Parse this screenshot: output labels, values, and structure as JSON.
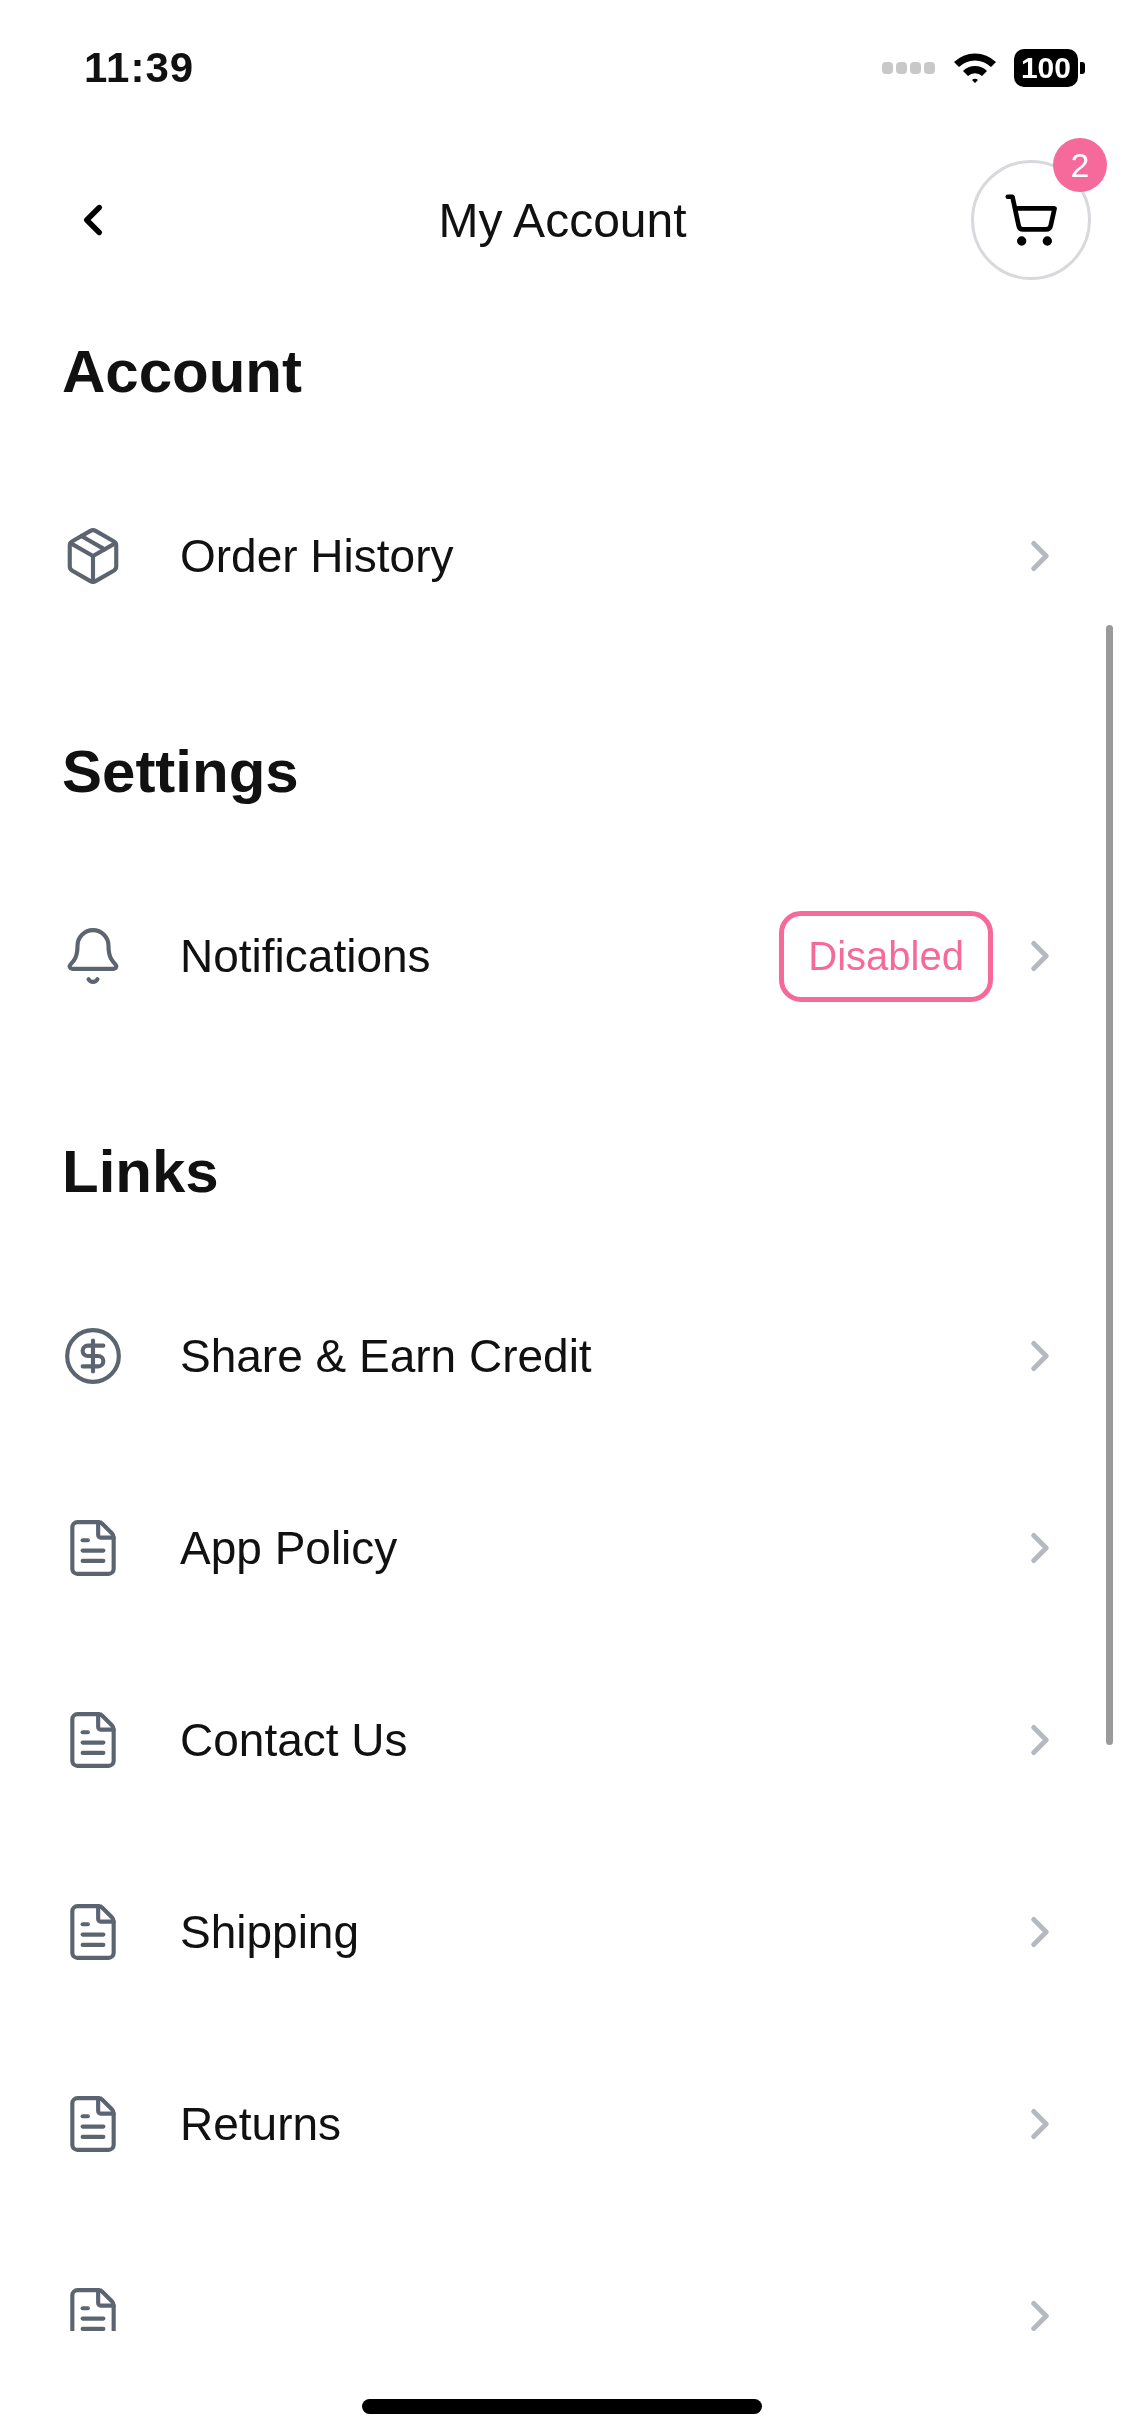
{
  "status_bar": {
    "time": "11:39",
    "battery": "100"
  },
  "header": {
    "title": "My Account",
    "cart_count": "2"
  },
  "sections": [
    {
      "title": "Account",
      "items": [
        {
          "kind": "box",
          "label": "Order History"
        }
      ]
    },
    {
      "title": "Settings",
      "items": [
        {
          "kind": "bell",
          "label": "Notifications",
          "badge": "Disabled"
        }
      ]
    },
    {
      "title": "Links",
      "items": [
        {
          "kind": "dollar",
          "label": "Share & Earn Credit"
        },
        {
          "kind": "document",
          "label": "App Policy"
        },
        {
          "kind": "document",
          "label": "Contact Us"
        },
        {
          "kind": "document",
          "label": "Shipping"
        },
        {
          "kind": "document",
          "label": "Returns"
        },
        {
          "kind": "document"
        }
      ]
    }
  ]
}
